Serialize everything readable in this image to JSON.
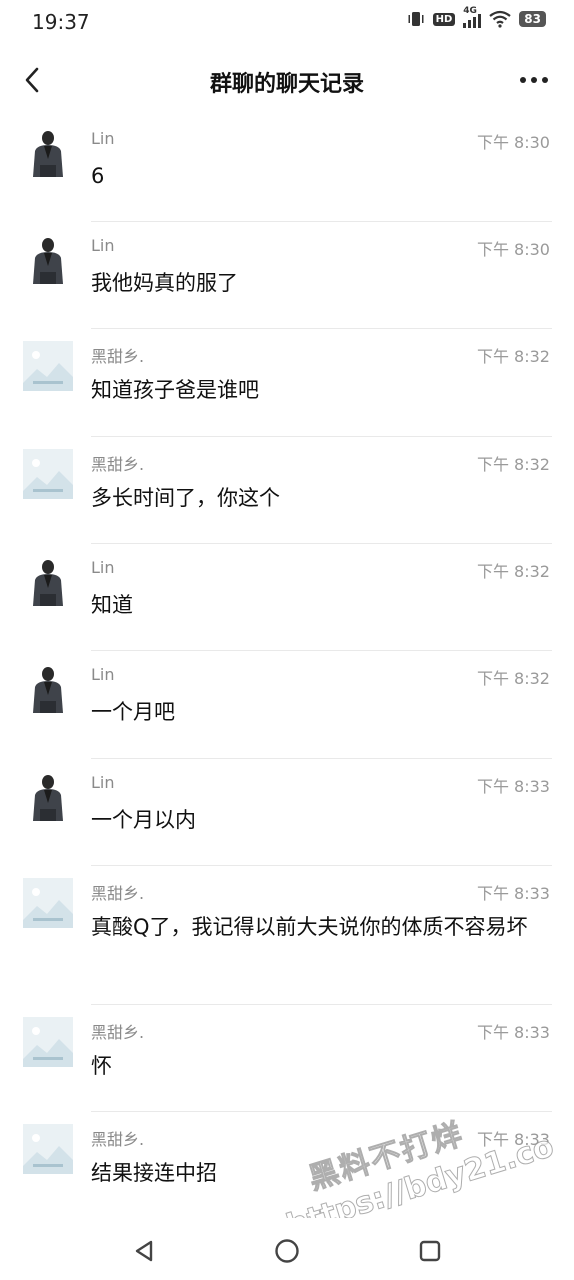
{
  "status_bar": {
    "time": "19:37",
    "network": "4G",
    "hd_badge": "HD",
    "battery": "83"
  },
  "header": {
    "title": "群聊的聊天记录",
    "back_icon": "chevron-left-icon",
    "more_icon": "more-horizontal-icon"
  },
  "messages": [
    {
      "sender": "Lin",
      "time": "下午 8:30",
      "text": "6",
      "avatar": "person-photo"
    },
    {
      "sender": "Lin",
      "time": "下午 8:30",
      "text": "我他妈真的服了",
      "avatar": "person-photo"
    },
    {
      "sender": "黑甜乡.",
      "time": "下午 8:32",
      "text": "知道孩子爸是谁吧",
      "avatar": "landscape-placeholder"
    },
    {
      "sender": "黑甜乡.",
      "time": "下午 8:32",
      "text": "多长时间了，你这个",
      "avatar": "landscape-placeholder"
    },
    {
      "sender": "Lin",
      "time": "下午 8:32",
      "text": "知道",
      "avatar": "person-photo"
    },
    {
      "sender": "Lin",
      "time": "下午 8:32",
      "text": "一个月吧",
      "avatar": "person-photo"
    },
    {
      "sender": "Lin",
      "time": "下午 8:33",
      "text": "一个月以内",
      "avatar": "person-photo"
    },
    {
      "sender": "黑甜乡.",
      "time": "下午 8:33",
      "text": "真酸Q了，我记得以前大夫说你的体质不容易坏",
      "avatar": "landscape-placeholder"
    },
    {
      "sender": "黑甜乡.",
      "time": "下午 8:33",
      "text": "怀",
      "avatar": "landscape-placeholder"
    },
    {
      "sender": "黑甜乡.",
      "time": "下午 8:33",
      "text": "结果接连中招",
      "avatar": "landscape-placeholder"
    }
  ],
  "watermark": {
    "line1": "黑料不打烊",
    "line2": "https://bdy21.co"
  },
  "nav_bar": {
    "back_icon": "triangle-back-icon",
    "home_icon": "circle-home-icon",
    "recents_icon": "square-recents-icon"
  },
  "colors": {
    "text_primary": "#111111",
    "text_secondary": "#8a8a8a",
    "divider": "#e9e9e9",
    "background": "#ffffff"
  }
}
